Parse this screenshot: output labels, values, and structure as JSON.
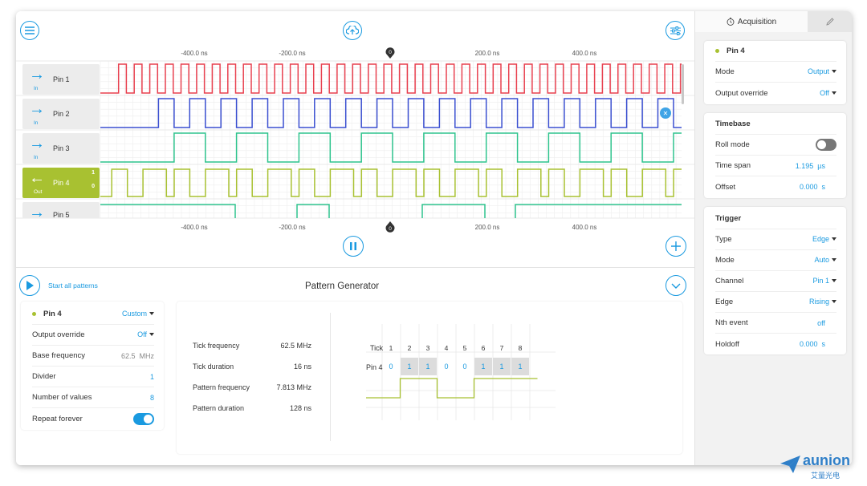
{
  "osc": {
    "axis_top": [
      "-400.0 ns",
      "-200.0 ns",
      "0",
      "200.0 ns",
      "400.0 ns"
    ],
    "axis_bottom": [
      "-400.0 ns",
      "-200.0 ns",
      "0",
      "200.0 ns",
      "400.0 ns"
    ],
    "pins": [
      {
        "name": "Pin 1",
        "dir": "In",
        "color": "#e8404f",
        "half_period": 16
      },
      {
        "name": "Pin 2",
        "dir": "In",
        "color": "#3a4fd0",
        "half_period": 32
      },
      {
        "name": "Pin 3",
        "dir": "In",
        "color": "#2ec48d",
        "half_period": 64
      },
      {
        "name": "Pin 4",
        "dir": "Out",
        "color": "#a8c131",
        "high": "1",
        "low": "0"
      },
      {
        "name": "Pin 5",
        "dir": "In",
        "color": "#2ec48d"
      }
    ]
  },
  "pattern": {
    "start_all": "Start all patterns",
    "title": "Pattern Generator",
    "pin_name": "Pin 4",
    "preset": "Custom",
    "settings": [
      {
        "label": "Output override",
        "value": "Off",
        "dropdown": true
      },
      {
        "label": "Base frequency",
        "value": "62.5  MHz",
        "muted": true
      },
      {
        "label": "Divider",
        "value": "1"
      },
      {
        "label": "Number of values",
        "value": "8"
      },
      {
        "label": "Repeat forever",
        "toggle": true,
        "on": true
      }
    ],
    "info": [
      {
        "label": "Tick frequency",
        "value": "62.5 MHz"
      },
      {
        "label": "Tick duration",
        "value": "16 ns"
      },
      {
        "label": "Pattern frequency",
        "value": "7.813 MHz"
      },
      {
        "label": "Pattern duration",
        "value": "128 ns"
      }
    ],
    "tick_label": "Tick",
    "row_label": "Pin 4",
    "ticks": [
      "1",
      "2",
      "3",
      "4",
      "5",
      "6",
      "7",
      "8"
    ],
    "values": [
      0,
      1,
      1,
      0,
      0,
      1,
      1,
      1
    ],
    "value_labels": [
      "0",
      "1",
      "1",
      "0",
      "0",
      "1",
      "1",
      "1"
    ]
  },
  "right": {
    "tab_acquisition": "Acquisition",
    "pin_card": {
      "title": "Pin 4",
      "rows": [
        {
          "label": "Mode",
          "value": "Output",
          "dropdown": true
        },
        {
          "label": "Output override",
          "value": "Off",
          "dropdown": true
        }
      ]
    },
    "timebase": {
      "title": "Timebase",
      "rows": [
        {
          "label": "Roll mode",
          "toggle": true,
          "on": false
        },
        {
          "label": "Time span",
          "value": "1.195  µs"
        },
        {
          "label": "Offset",
          "value": "0.000  s"
        }
      ]
    },
    "trigger": {
      "title": "Trigger",
      "rows": [
        {
          "label": "Type",
          "value": "Edge",
          "dropdown": true
        },
        {
          "label": "Mode",
          "value": "Auto",
          "dropdown": true
        },
        {
          "label": "Channel",
          "value": "Pin 1",
          "dropdown": true
        },
        {
          "label": "Edge",
          "value": "Rising",
          "dropdown": true
        },
        {
          "label": "Nth event",
          "value": "off"
        },
        {
          "label": "Holdoff",
          "value": "0.000  s"
        }
      ]
    }
  },
  "logo": {
    "text": "aunion",
    "subtext": "艾量光电"
  },
  "colors": {
    "accent": "#1a9ae0",
    "pin4": "#a8c131"
  }
}
